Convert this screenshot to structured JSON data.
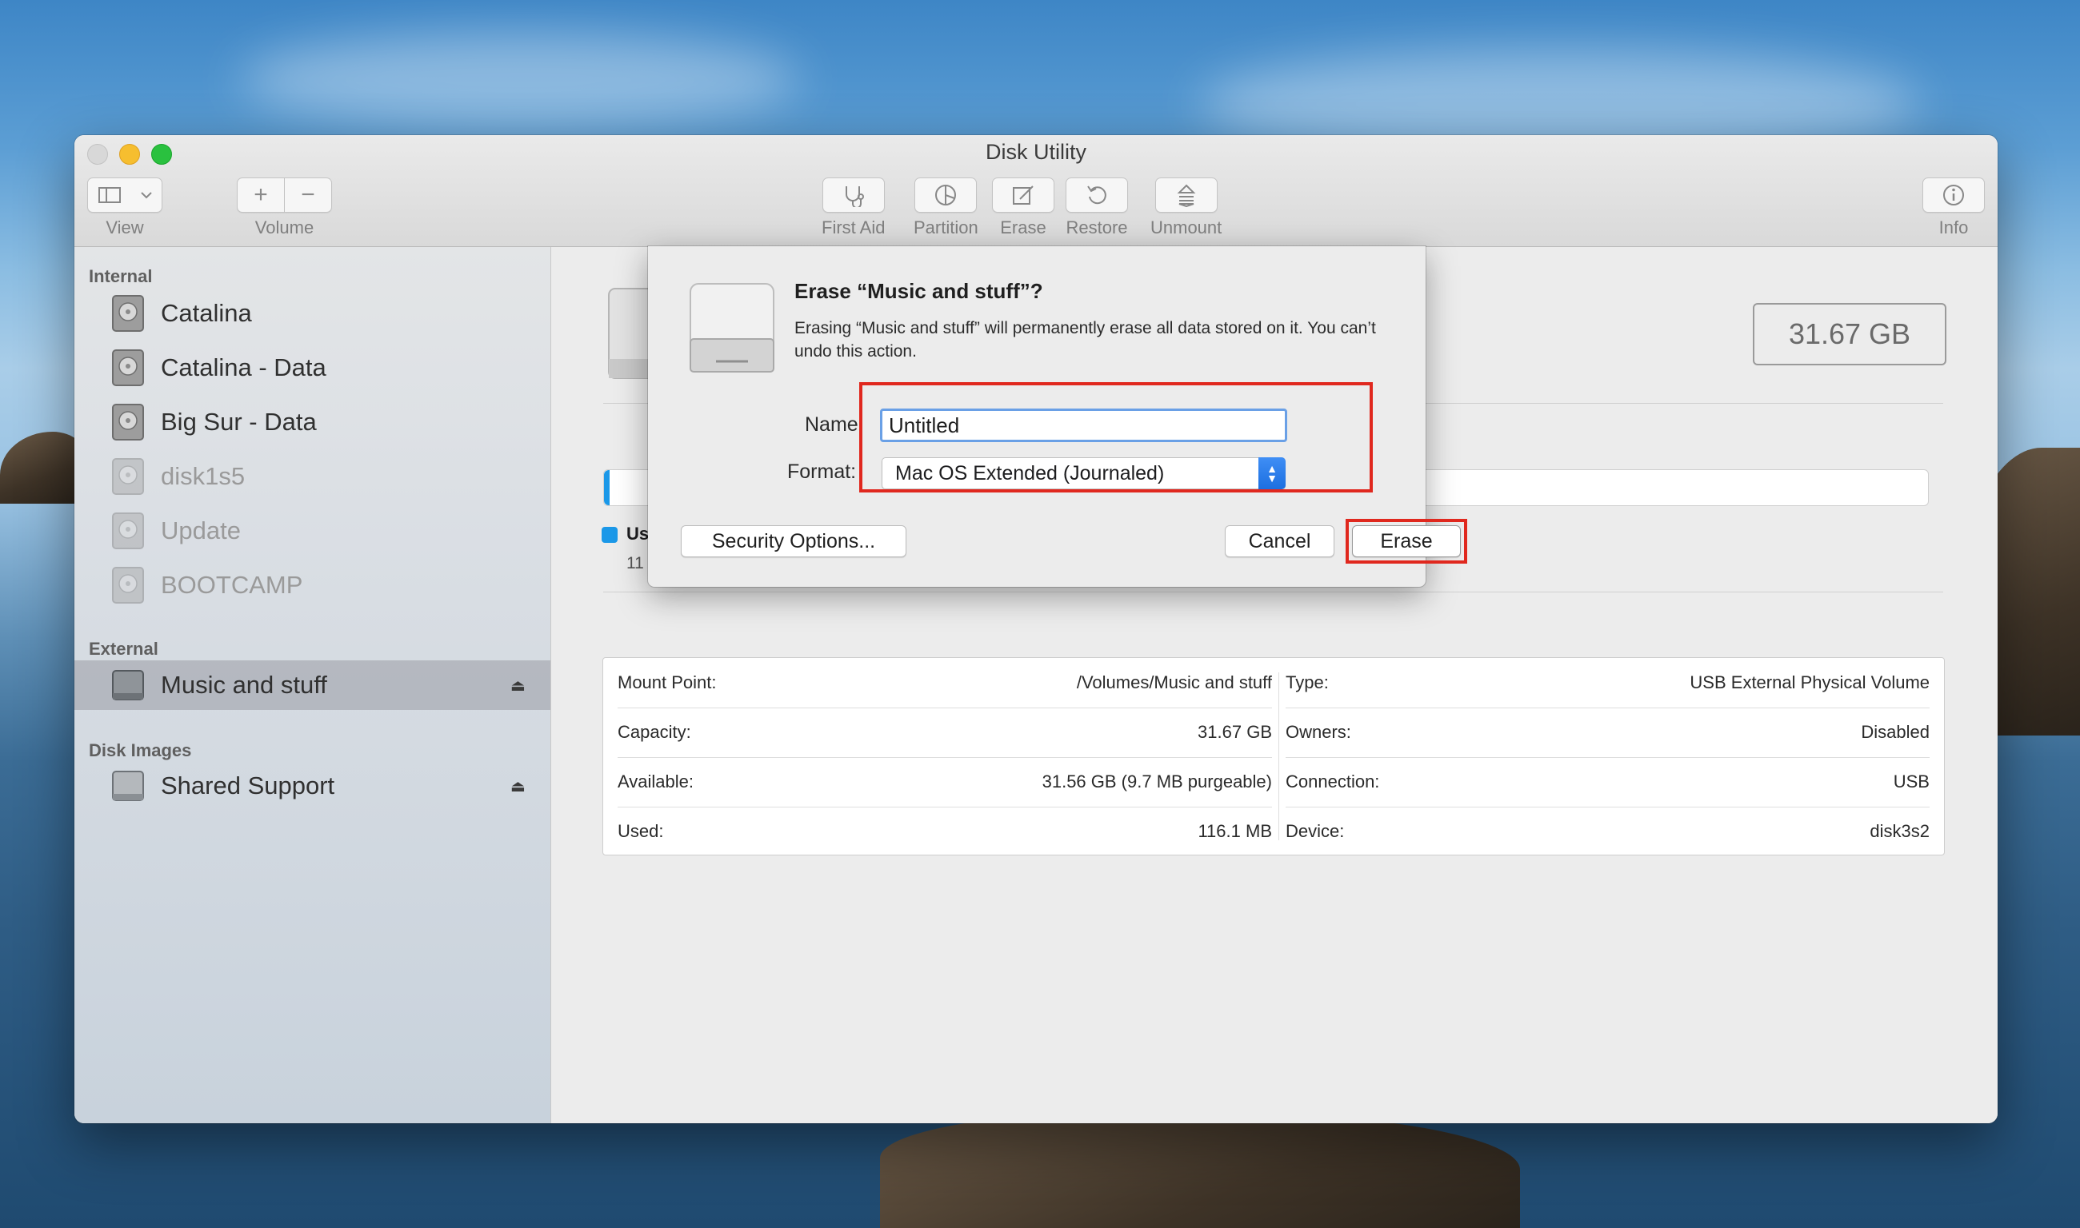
{
  "window": {
    "title": "Disk Utility"
  },
  "toolbar": {
    "view_label": "View",
    "volume_label": "Volume",
    "first_aid_label": "First Aid",
    "partition_label": "Partition",
    "erase_label": "Erase",
    "restore_label": "Restore",
    "unmount_label": "Unmount",
    "info_label": "Info"
  },
  "sidebar": {
    "internal_header": "Internal",
    "internal_items": [
      {
        "label": "Catalina"
      },
      {
        "label": "Catalina - Data"
      },
      {
        "label": "Big Sur - Data"
      },
      {
        "label": "disk1s5"
      },
      {
        "label": "Update"
      },
      {
        "label": "BOOTCAMP"
      }
    ],
    "external_header": "External",
    "external_items": [
      {
        "label": "Music and stuff"
      }
    ],
    "disk_images_header": "Disk Images",
    "disk_image_items": [
      {
        "label": "Shared Support"
      }
    ],
    "eject_glyph": "⏏"
  },
  "main": {
    "capacity_badge": "31.67 GB",
    "usage_legend_label": "Us",
    "usage_legend_value": "11",
    "usage_fraction": 0.004,
    "info": {
      "mount_point_label": "Mount Point:",
      "mount_point_value": "/Volumes/Music and stuff",
      "capacity_label": "Capacity:",
      "capacity_value": "31.67 GB",
      "available_label": "Available:",
      "available_value": "31.56 GB (9.7 MB purgeable)",
      "used_label": "Used:",
      "used_value": "116.1 MB",
      "type_label": "Type:",
      "type_value": "USB External Physical Volume",
      "owners_label": "Owners:",
      "owners_value": "Disabled",
      "connection_label": "Connection:",
      "connection_value": "USB",
      "device_label": "Device:",
      "device_value": "disk3s2"
    }
  },
  "dialog": {
    "title": "Erase “Music and stuff”?",
    "message": "Erasing “Music and stuff” will permanently erase all data stored on it. You can’t undo this action.",
    "name_label": "Name:",
    "name_value": "Untitled",
    "format_label": "Format:",
    "format_value": "Mac OS Extended (Journaled)",
    "security_options_label": "Security Options...",
    "cancel_label": "Cancel",
    "erase_label": "Erase"
  },
  "colors": {
    "highlight_box": "#e0281e",
    "accent": "#1c6fe0",
    "usage_bar": "#1b98e8"
  }
}
